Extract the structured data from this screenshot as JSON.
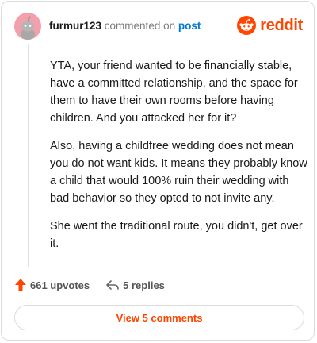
{
  "comment": {
    "username": "furmur123",
    "action_text": "commented on",
    "post_link": "post",
    "paragraphs": [
      "YTA, your friend wanted to be financially stable, have a committed relationship, and the space for them to have their own rooms before having children. And you attacked her for it?",
      "Also, having a childfree wedding does not mean you do not want kids. It means they probably know a child that would 100% ruin their wedding with bad behavior so they opted to not invite any.",
      "She went the traditional route, you didn't, get over it."
    ]
  },
  "brand": {
    "wordmark": "reddit",
    "color": "#ff4500",
    "icon": "reddit-snoo-icon"
  },
  "actions": {
    "upvotes": "661 upvotes",
    "replies": "5 replies",
    "upvote_icon": "upvote-arrow-icon",
    "reply_icon": "reply-arrow-icon"
  },
  "view_comments": "View 5 comments",
  "colors": {
    "accent": "#ff4500",
    "link": "#0079d3",
    "avatar_bg": "#f3a0ad"
  }
}
